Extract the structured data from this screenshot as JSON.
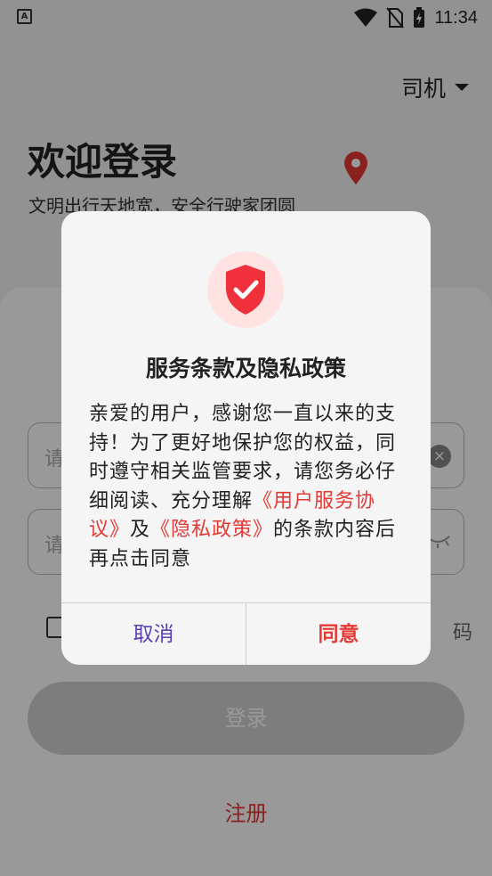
{
  "statusbar": {
    "notif_icon": "A",
    "time": "11:34"
  },
  "page": {
    "role": "司机",
    "welcome": "欢迎登录",
    "subtitle": "文明出行天地宽，安全行驶家团圆",
    "field1_placeholder": "请",
    "field2_placeholder": "请",
    "forgot_partial": "码",
    "login": "登录",
    "register": "注册"
  },
  "dialog": {
    "title": "服务条款及隐私政策",
    "body_part1": "亲爱的用户，感谢您一直以来的支持！为了更好地保护您的权益，同时遵守相关监管要求，请您务必仔细阅读、充分理解",
    "user_agreement_link": "《用户服务协议》",
    "and_text": "及",
    "privacy_link": "《隐私政策》",
    "body_part2": "的条款内容后再点击同意",
    "cancel": "取消",
    "agree": "同意"
  },
  "colors": {
    "accent_red": "#e53935",
    "cancel_purple": "#5b3fb5",
    "shield_bg": "#ffe3e3"
  }
}
